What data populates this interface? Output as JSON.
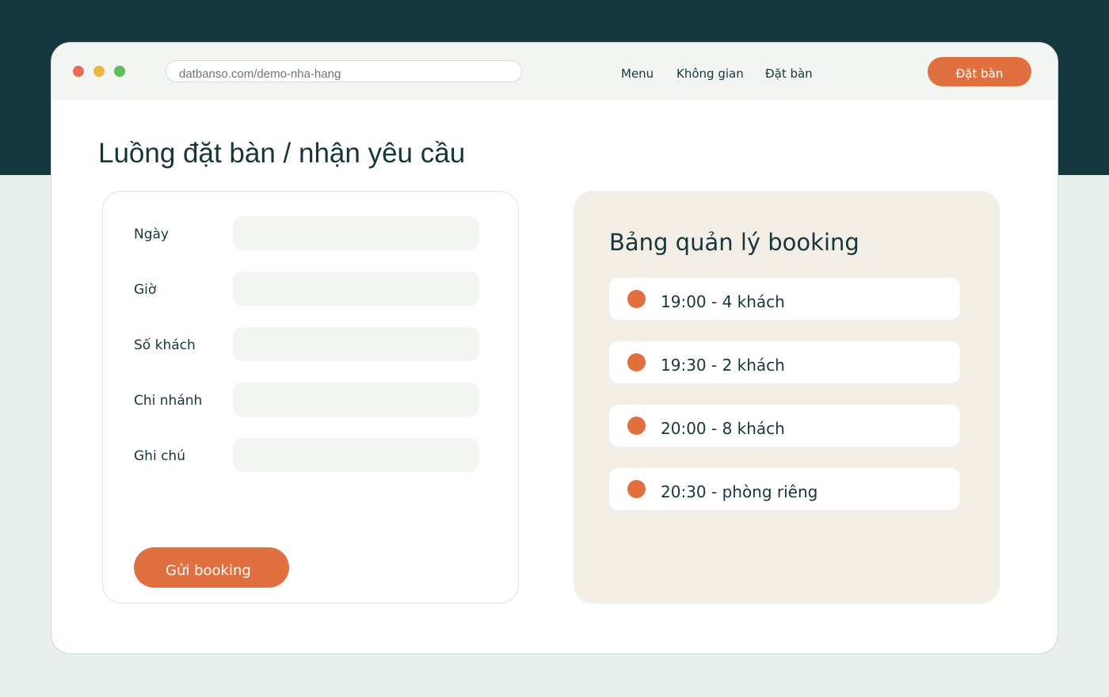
{
  "browser": {
    "url": "datbanso.com/demo-nha-hang"
  },
  "nav": {
    "menu": "Menu",
    "space": "Không gian",
    "reserve": "Đặt bàn",
    "cta": "Đặt bàn"
  },
  "page": {
    "title": "Luồng đặt bàn / nhận yêu cầu"
  },
  "form": {
    "fields": [
      {
        "label": "Ngày",
        "value": ""
      },
      {
        "label": "Giờ",
        "value": ""
      },
      {
        "label": "Số khách",
        "value": ""
      },
      {
        "label": "Chi nhánh",
        "value": ""
      },
      {
        "label": "Ghi chú",
        "value": ""
      }
    ],
    "submit": "Gửi booking"
  },
  "panel": {
    "title": "Bảng quản lý booking",
    "items": [
      {
        "text": "19:00 - 4 khách"
      },
      {
        "text": "19:30 - 2 khách"
      },
      {
        "text": "20:00 - 8 khách"
      },
      {
        "text": "20:30 - phòng riêng"
      }
    ]
  },
  "colors": {
    "accent": "#e0703f",
    "dark": "#14363d",
    "panel_bg": "#f3efe7",
    "input_bg": "#f3f5f2"
  }
}
